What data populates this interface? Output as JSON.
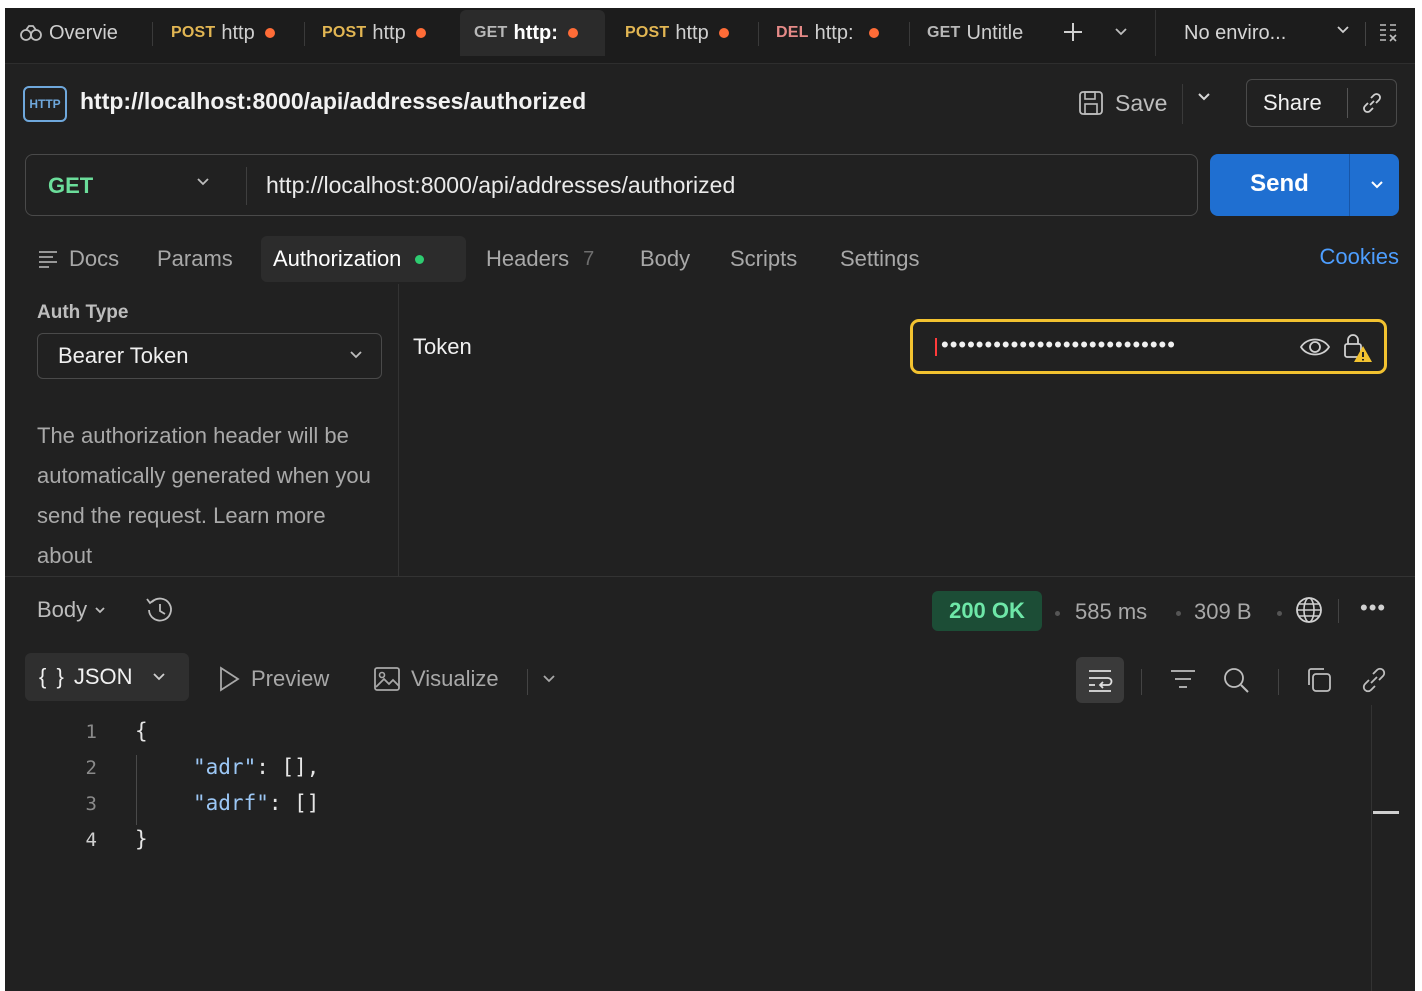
{
  "tabs": [
    {
      "method": "",
      "name": "Overvie",
      "dirty": false
    },
    {
      "method": "POST",
      "name": "http",
      "dirty": true
    },
    {
      "method": "POST",
      "name": "http",
      "dirty": true
    },
    {
      "method": "GET",
      "name": "http:",
      "dirty": true,
      "active": true
    },
    {
      "method": "POST",
      "name": "http",
      "dirty": true
    },
    {
      "method": "DEL",
      "name": "http:",
      "dirty": true
    },
    {
      "method": "GET",
      "name": "Untitle",
      "dirty": false
    }
  ],
  "environment": {
    "label": "No enviro..."
  },
  "request": {
    "title": "http://localhost:8000/api/addresses/authorized",
    "http_badge": "HTTP",
    "save_label": "Save",
    "share_label": "Share",
    "method": "GET",
    "url": "http://localhost:8000/api/addresses/authorized",
    "send_label": "Send"
  },
  "request_tabs": {
    "docs": "Docs",
    "params": "Params",
    "authorization": "Authorization",
    "headers": "Headers",
    "headers_count": "7",
    "body": "Body",
    "scripts": "Scripts",
    "settings": "Settings",
    "cookies": "Cookies"
  },
  "auth": {
    "type_label": "Auth Type",
    "type_value": "Bearer Token",
    "description": "The authorization header will be automatically generated when you send the request. Learn more about",
    "token_label": "Token",
    "token_masked": "•••••••••••••••••••••••••••"
  },
  "response": {
    "body_label": "Body",
    "status": "200 OK",
    "time": "585 ms",
    "size": "309 B",
    "more": "•••",
    "format": "JSON",
    "format_glyph": "{ }",
    "preview": "Preview",
    "visualize": "Visualize",
    "lines": [
      {
        "n": "1",
        "text": "{"
      },
      {
        "n": "2",
        "key": "\"adr\"",
        "rest": ": [],"
      },
      {
        "n": "3",
        "key": "\"adrf\"",
        "rest": ": []"
      },
      {
        "n": "4",
        "text": "}"
      }
    ]
  },
  "colors": {
    "accent_send": "#1f6fd1",
    "dirty_dot": "#ff6c37",
    "status_ok": "#6ee7a8",
    "token_focus": "#f2c230",
    "link": "#4d9eff"
  },
  "icons": [
    "overview-icon",
    "new-tab-icon",
    "tab-list-chevron-icon",
    "env-quick-look-icon",
    "http-icon",
    "save-icon",
    "chevron-down-icon",
    "link-icon",
    "docs-icon",
    "eye-icon",
    "lock-warning-icon",
    "history-icon",
    "globe-icon",
    "play-icon",
    "image-icon",
    "wrap-icon",
    "filter-icon",
    "search-icon",
    "copy-icon"
  ]
}
